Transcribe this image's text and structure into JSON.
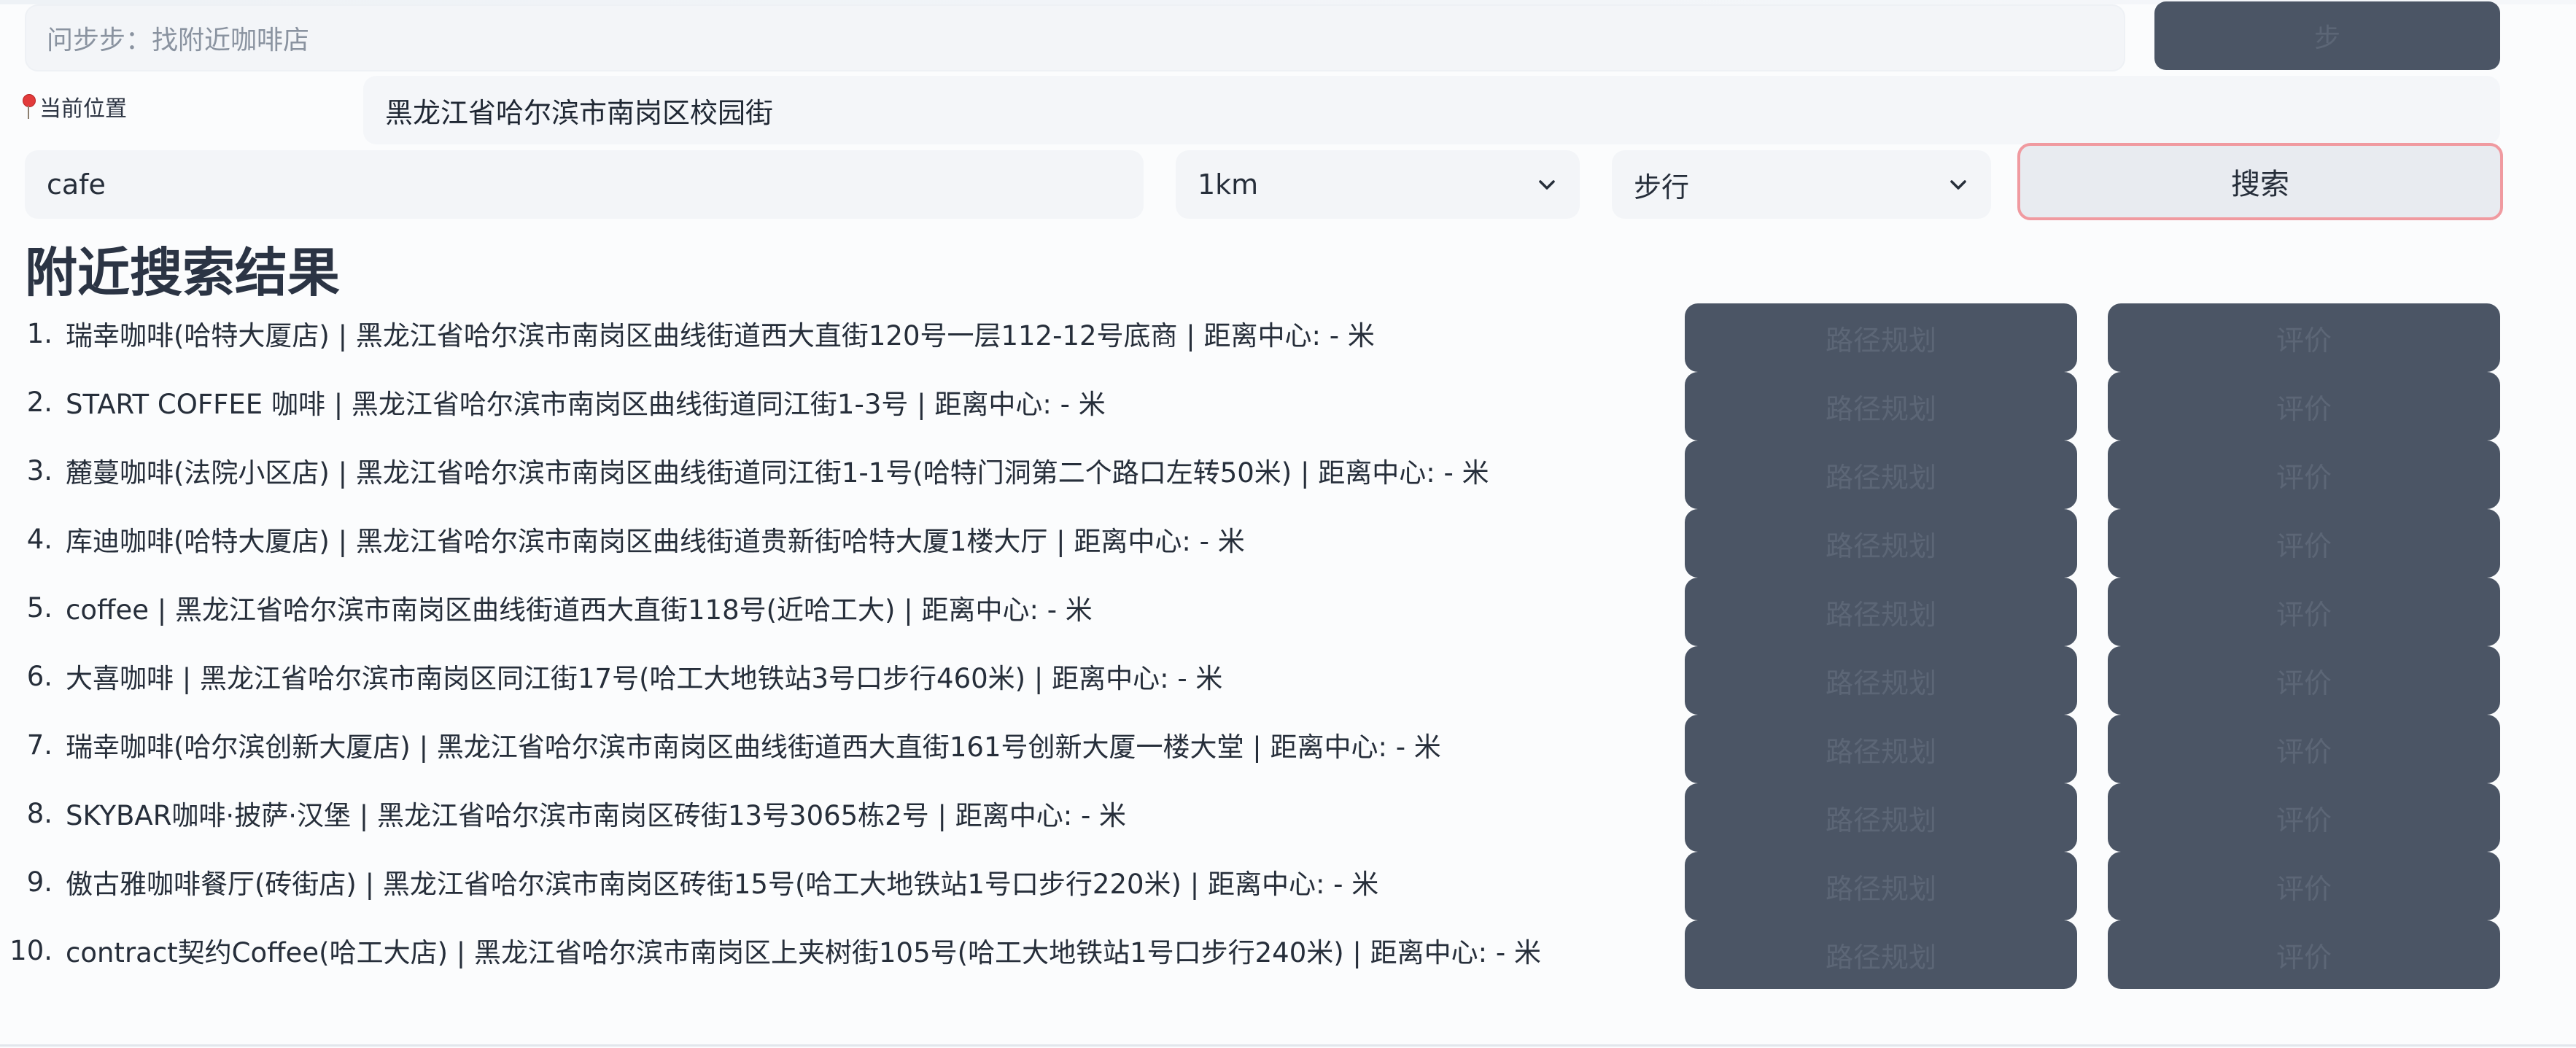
{
  "ask": {
    "placeholder": "问步步：找附近咖啡店",
    "button_label": "步"
  },
  "location": {
    "label": "当前位置",
    "value": "黑龙江省哈尔滨市南岗区校园街"
  },
  "search": {
    "keyword": "cafe",
    "range": "1km",
    "mode": "步行",
    "button_label": "搜索"
  },
  "results": {
    "title": "附近搜索结果",
    "route_label": "路径规划",
    "review_label": "评价",
    "items": [
      {
        "num": "1.",
        "text": "瑞幸咖啡(哈特大厦店) | 黑龙江省哈尔滨市南岗区曲线街道西大直街120号一层112-12号底商 | 距离中心: - 米"
      },
      {
        "num": "2.",
        "text": "START COFFEE 咖啡 | 黑龙江省哈尔滨市南岗区曲线街道同江街1-3号 | 距离中心: - 米"
      },
      {
        "num": "3.",
        "text": "麓蔓咖啡(法院小区店) | 黑龙江省哈尔滨市南岗区曲线街道同江街1-1号(哈特门洞第二个路口左转50米) | 距离中心: - 米"
      },
      {
        "num": "4.",
        "text": "库迪咖啡(哈特大厦店) | 黑龙江省哈尔滨市南岗区曲线街道贵新街哈特大厦1楼大厅 | 距离中心: - 米"
      },
      {
        "num": "5.",
        "text": "coffee | 黑龙江省哈尔滨市南岗区曲线街道西大直街118号(近哈工大) | 距离中心: - 米"
      },
      {
        "num": "6.",
        "text": "大喜咖啡 | 黑龙江省哈尔滨市南岗区同江街17号(哈工大地铁站3号口步行460米) | 距离中心: - 米"
      },
      {
        "num": "7.",
        "text": "瑞幸咖啡(哈尔滨创新大厦店) | 黑龙江省哈尔滨市南岗区曲线街道西大直街161号创新大厦一楼大堂 | 距离中心: - 米"
      },
      {
        "num": "8.",
        "text": "SKYBAR咖啡·披萨·汉堡 | 黑龙江省哈尔滨市南岗区砖街13号3065栋2号 | 距离中心: - 米"
      },
      {
        "num": "9.",
        "text": "傲古雅咖啡餐厅(砖街店) | 黑龙江省哈尔滨市南岗区砖街15号(哈工大地铁站1号口步行220米) | 距离中心: - 米"
      },
      {
        "num": "10.",
        "text": "contract契约Coffee(哈工大店) | 黑龙江省哈尔滨市南岗区上夹树街105号(哈工大地铁站1号口步行240米) | 距离中心: - 米"
      }
    ]
  }
}
